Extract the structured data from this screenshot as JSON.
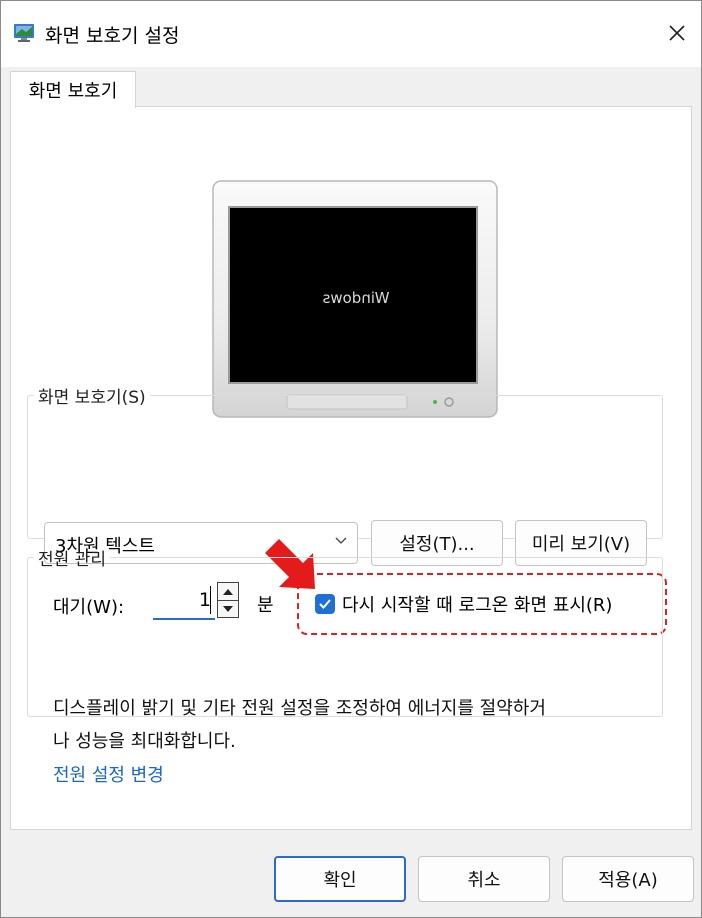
{
  "window": {
    "title": "화면 보호기 설정",
    "icon": "monitor-app-icon",
    "close_icon": "close-icon"
  },
  "tab": {
    "label": "화면 보호기"
  },
  "preview": {
    "text": "Windows"
  },
  "screensaver": {
    "group_label": "화면 보호기(S)",
    "selected": "3차원 텍스트",
    "settings_button": "설정(T)...",
    "preview_button": "미리 보기(V)",
    "wait_label": "대기(W):",
    "wait_value": "1",
    "minute_label": "분",
    "logon_checkbox_label": "다시 시작할 때 로그온 화면 표시(R)",
    "logon_checked": true
  },
  "power": {
    "group_label": "전원 관리",
    "description_line1": "디스플레이 밝기 및 기타 전원 설정을 조정하여 에너지를 절약하거",
    "description_line2": "나 성능을 최대화합니다.",
    "link": "전원 설정 변경"
  },
  "footer": {
    "ok": "확인",
    "cancel": "취소",
    "apply": "적용(A)"
  },
  "colors": {
    "accent": "#1f6fd6",
    "link": "#1a66c9",
    "annotation": "#e02020"
  }
}
